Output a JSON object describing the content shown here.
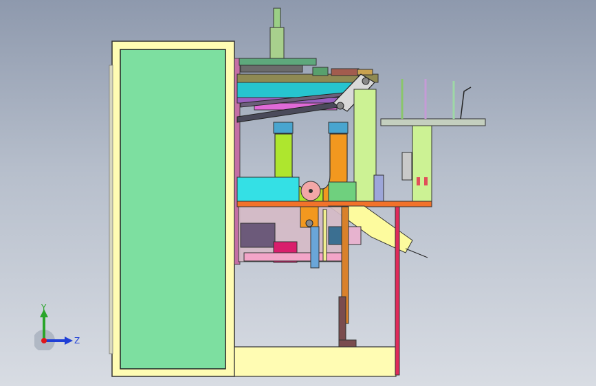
{
  "viewport": {
    "background_top": "#8e99ad",
    "background_bottom": "#d8dce3"
  },
  "triad": {
    "y_label": "Y",
    "z_label": "Z",
    "y_color": "#2aa52a",
    "z_color": "#1f3fd6",
    "x_color": "#e0161a",
    "icon": "view-orientation-triad-icon"
  },
  "model": {
    "icon": "machine-assembly-side-view"
  }
}
